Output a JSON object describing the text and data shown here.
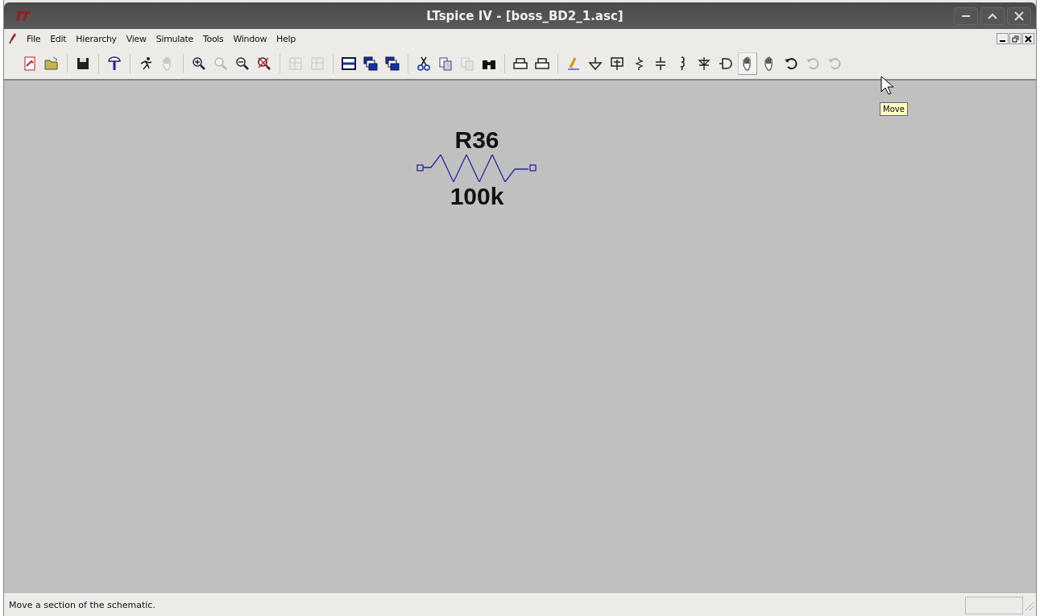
{
  "window": {
    "title": "LTspice IV - [boss_BD2_1.asc]"
  },
  "menu": [
    {
      "label": "File"
    },
    {
      "label": "Edit"
    },
    {
      "label": "Hierarchy"
    },
    {
      "label": "View"
    },
    {
      "label": "Simulate"
    },
    {
      "label": "Tools"
    },
    {
      "label": "Window"
    },
    {
      "label": "Help"
    }
  ],
  "toolbar": [
    [
      {
        "kind": "new",
        "disabled": false
      },
      {
        "kind": "open",
        "disabled": false
      }
    ],
    [
      {
        "kind": "save",
        "disabled": false
      }
    ],
    [
      {
        "kind": "probe",
        "disabled": false
      }
    ],
    [
      {
        "kind": "run",
        "disabled": false
      },
      {
        "kind": "halt",
        "disabled": true
      }
    ],
    [
      {
        "kind": "zoomin",
        "disabled": false
      },
      {
        "kind": "zoompan",
        "disabled": true
      },
      {
        "kind": "zoomout",
        "disabled": false
      },
      {
        "kind": "zoomcancel",
        "disabled": false
      }
    ],
    [
      {
        "kind": "tilev",
        "disabled": true
      },
      {
        "kind": "tileh",
        "disabled": true
      }
    ],
    [
      {
        "kind": "horiz",
        "disabled": false
      },
      {
        "kind": "cascade",
        "disabled": false
      },
      {
        "kind": "arrange",
        "disabled": false
      }
    ],
    [
      {
        "kind": "cut",
        "disabled": false
      },
      {
        "kind": "copy",
        "disabled": false
      },
      {
        "kind": "paste",
        "disabled": true
      },
      {
        "kind": "find",
        "disabled": false
      }
    ],
    [
      {
        "kind": "printsetup",
        "disabled": false
      },
      {
        "kind": "print",
        "disabled": false
      }
    ],
    [
      {
        "kind": "wire",
        "disabled": false
      },
      {
        "kind": "ground",
        "disabled": false
      },
      {
        "kind": "label",
        "disabled": false
      },
      {
        "kind": "resistor",
        "disabled": false
      },
      {
        "kind": "capacitor",
        "disabled": false
      },
      {
        "kind": "inductor",
        "disabled": false
      },
      {
        "kind": "diode",
        "disabled": false
      },
      {
        "kind": "component",
        "disabled": false
      },
      {
        "kind": "move",
        "disabled": false,
        "hovered": true
      },
      {
        "kind": "drag",
        "disabled": false
      },
      {
        "kind": "undo",
        "disabled": false
      },
      {
        "kind": "redo",
        "disabled": true
      },
      {
        "kind": "rotate",
        "disabled": true
      }
    ]
  ],
  "tooltip": "Move",
  "schematic": {
    "components": [
      {
        "kind": "resistor",
        "name": "R36",
        "value": "100k"
      }
    ]
  },
  "status_bar": {
    "text": "Move a section of the schematic."
  }
}
